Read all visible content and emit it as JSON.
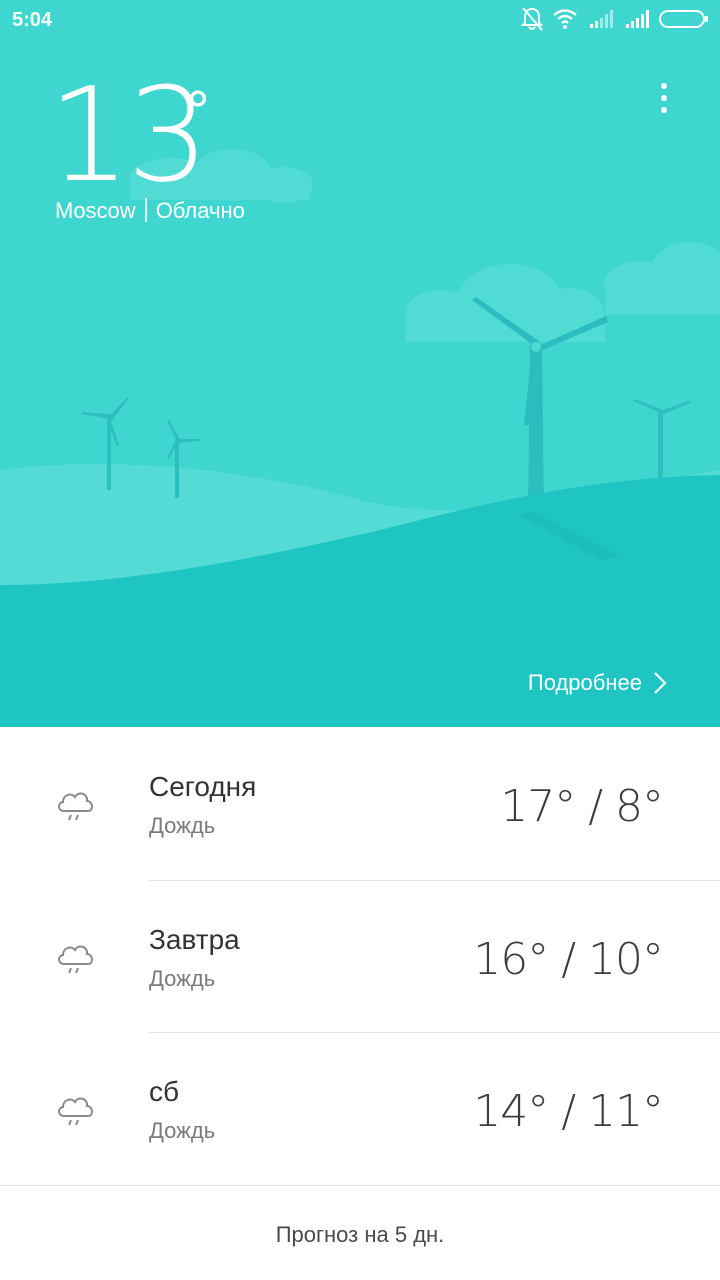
{
  "status_bar": {
    "time": "5:04",
    "icons": [
      "bell-muted-icon",
      "wifi-icon",
      "signal-1-icon",
      "signal-2-icon",
      "battery-icon"
    ]
  },
  "current": {
    "temperature": "13",
    "degree_symbol": "°",
    "city": "Moscow",
    "condition": "Облачно",
    "details_label": "Подробнее"
  },
  "forecast": [
    {
      "day": "Сегодня",
      "condition": "Дождь",
      "temps": "17° / 8°",
      "icon": "rain-cloud-icon"
    },
    {
      "day": "Завтра",
      "condition": "Дождь",
      "temps": "16° / 10°",
      "icon": "rain-cloud-icon"
    },
    {
      "day": "сб",
      "condition": "Дождь",
      "temps": "14° / 11°",
      "icon": "rain-cloud-icon"
    }
  ],
  "footer": {
    "five_day_label": "Прогноз на 5 дн."
  },
  "colors": {
    "hero_sky": "#3fd5d0",
    "hill_light": "#56dcd6",
    "hill_dark": "#1ec4c2",
    "turbine": "#2bbdbd"
  }
}
